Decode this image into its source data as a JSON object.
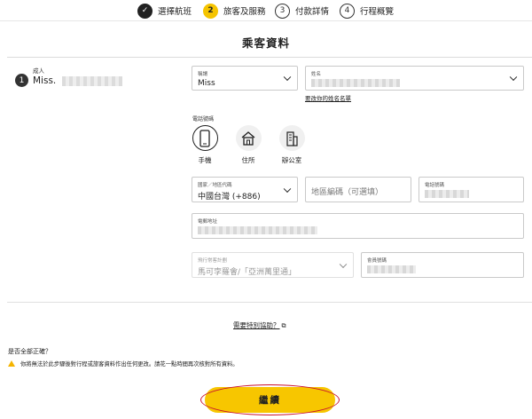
{
  "stepper": {
    "steps": [
      {
        "number": "✓",
        "label": "選擇航班",
        "state": "done"
      },
      {
        "number": "2",
        "label": "旅客及服務",
        "state": "active"
      },
      {
        "number": "3",
        "label": "付款詳情",
        "state": "pending"
      },
      {
        "number": "4",
        "label": "行程概覽",
        "state": "pending"
      }
    ]
  },
  "page_title": "乘客資料",
  "passenger": {
    "index": "1",
    "type": "成人",
    "name_prefix": "Miss."
  },
  "form": {
    "title_field": {
      "label": "稱謂",
      "value": "Miss"
    },
    "name_field": {
      "label": "姓名"
    },
    "name_link": "要改你的姓名名單",
    "phone_type_label": "電話號碼",
    "phone_types": [
      {
        "label": "手機",
        "icon": "mobile-phone-icon",
        "selected": true
      },
      {
        "label": "住所",
        "icon": "house-icon",
        "selected": false
      },
      {
        "label": "辦公室",
        "icon": "office-building-icon",
        "selected": false
      }
    ],
    "country_code_field": {
      "label": "國家／地區代碼",
      "value": "中國台灣 (+886)"
    },
    "area_code_field": {
      "placeholder": "地區編碼（可選填）"
    },
    "phone_number_field": {
      "label": "電話號碼"
    },
    "email_field": {
      "label": "電郵地址"
    },
    "ffp_field": {
      "label": "飛行常客計劃",
      "value": "馬可孛羅會/「亞洲萬里通」"
    },
    "member_number_field": {
      "label": "會員號碼"
    }
  },
  "special_assistance_link": "需要特別協助？",
  "confirm_question": "是否全部正確？",
  "warning_text": "你將無法於此步驟後對行程或旅客資料作出任何更改。請花一點時間再次核對所有資料。",
  "continue_label": "繼續",
  "colors": {
    "accent": "#f7c600",
    "highlight_ring": "#c8102e",
    "done": "#222222"
  }
}
